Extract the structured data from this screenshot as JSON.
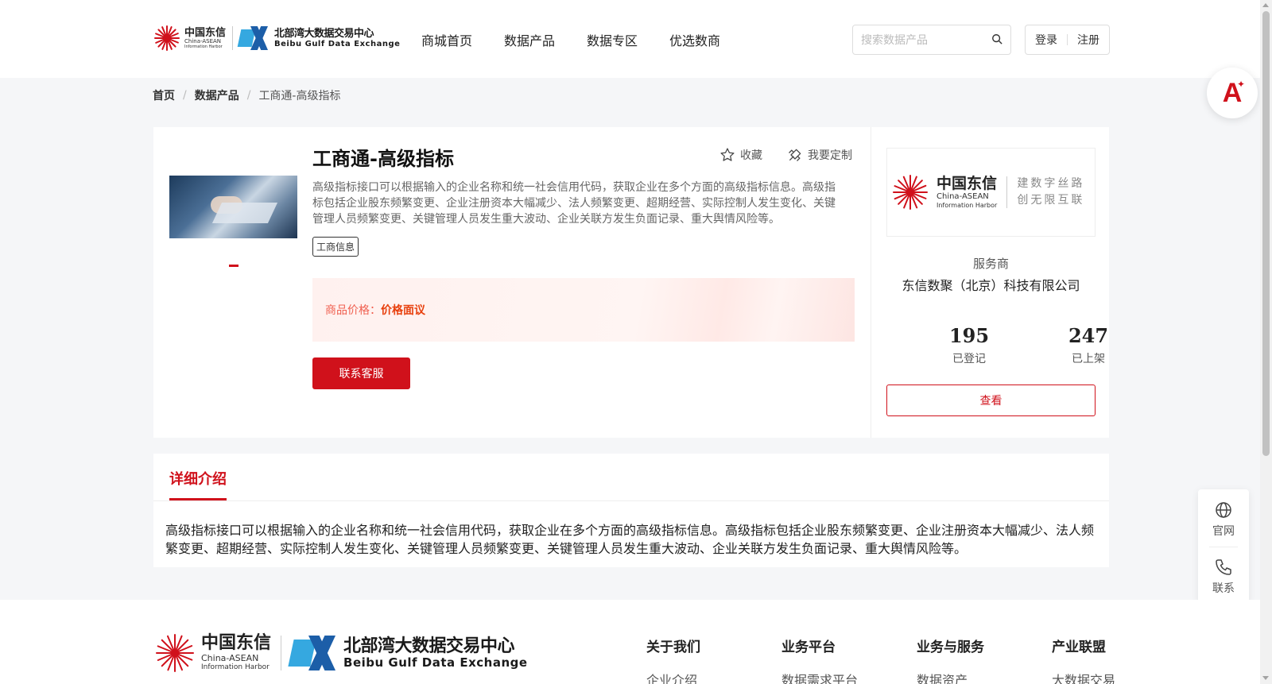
{
  "header": {
    "logo_cn": "中国东信",
    "logo_en1": "China-ASEAN",
    "logo_en2": "Information Harbor",
    "exchange_cn": "北部湾大数据交易中心",
    "exchange_en": "Beibu Gulf Data Exchange",
    "nav": [
      "商城首页",
      "数据产品",
      "数据专区",
      "优选数商"
    ],
    "search_placeholder": "搜索数据产品",
    "login": "登录",
    "register": "注册"
  },
  "breadcrumb": [
    "首页",
    "数据产品",
    "工商通-高级指标"
  ],
  "product": {
    "title": "工商通-高级指标",
    "favorite": "收藏",
    "customize": "我要定制",
    "description": "高级指标接口可以根据输入的企业名称和统一社会信用代码，获取企业在多个方面的高级指标信息。高级指标包括企业股东频繁变更、企业注册资本大幅减少、法人频繁变更、超期经营、实际控制人发生变化、关键管理人员频繁变更、关键管理人员发生重大波动、企业关联方发生负面记录、重大舆情风险等。",
    "tag": "工商信息",
    "price_label": "商品价格：",
    "price_value": "价格面议",
    "contact_button": "联系客服"
  },
  "provider": {
    "logo_cn": "中国东信",
    "logo_en1": "China-ASEAN",
    "logo_en2": "Information Harbor",
    "slogan1": "建数字丝路",
    "slogan2": "创无限互联",
    "role": "服务商",
    "name": "东信数聚（北京）科技有限公司",
    "registered_count": "195",
    "registered_label": "已登记",
    "listed_count": "247",
    "listed_label": "已上架",
    "view_button": "查看"
  },
  "detail": {
    "tab": "详细介绍",
    "body": "高级指标接口可以根据输入的企业名称和统一社会信用代码，获取企业在多个方面的高级指标信息。高级指标包括企业股东频繁变更、企业注册资本大幅减少、法人频繁变更、超期经营、实际控制人发生变化、关键管理人员频繁变更、关键管理人员发生重大波动、企业关联方发生负面记录、重大舆情风险等。"
  },
  "side": {
    "website": "官网",
    "contact": "联系"
  },
  "footer": {
    "logo_cn": "中国东信",
    "logo_en1": "China-ASEAN",
    "logo_en2": "Information Harbor",
    "exchange_cn": "北部湾大数据交易中心",
    "exchange_en": "Beibu Gulf Data Exchange",
    "columns": [
      {
        "title": "关于我们",
        "item": "企业介绍"
      },
      {
        "title": "业务平台",
        "item": "数据需求平台"
      },
      {
        "title": "业务与服务",
        "item": "数据资产"
      },
      {
        "title": "产业联盟",
        "item": "大数据交易"
      }
    ]
  },
  "colors": {
    "brand_red": "#d0111b",
    "price_orange": "#e8410f"
  }
}
